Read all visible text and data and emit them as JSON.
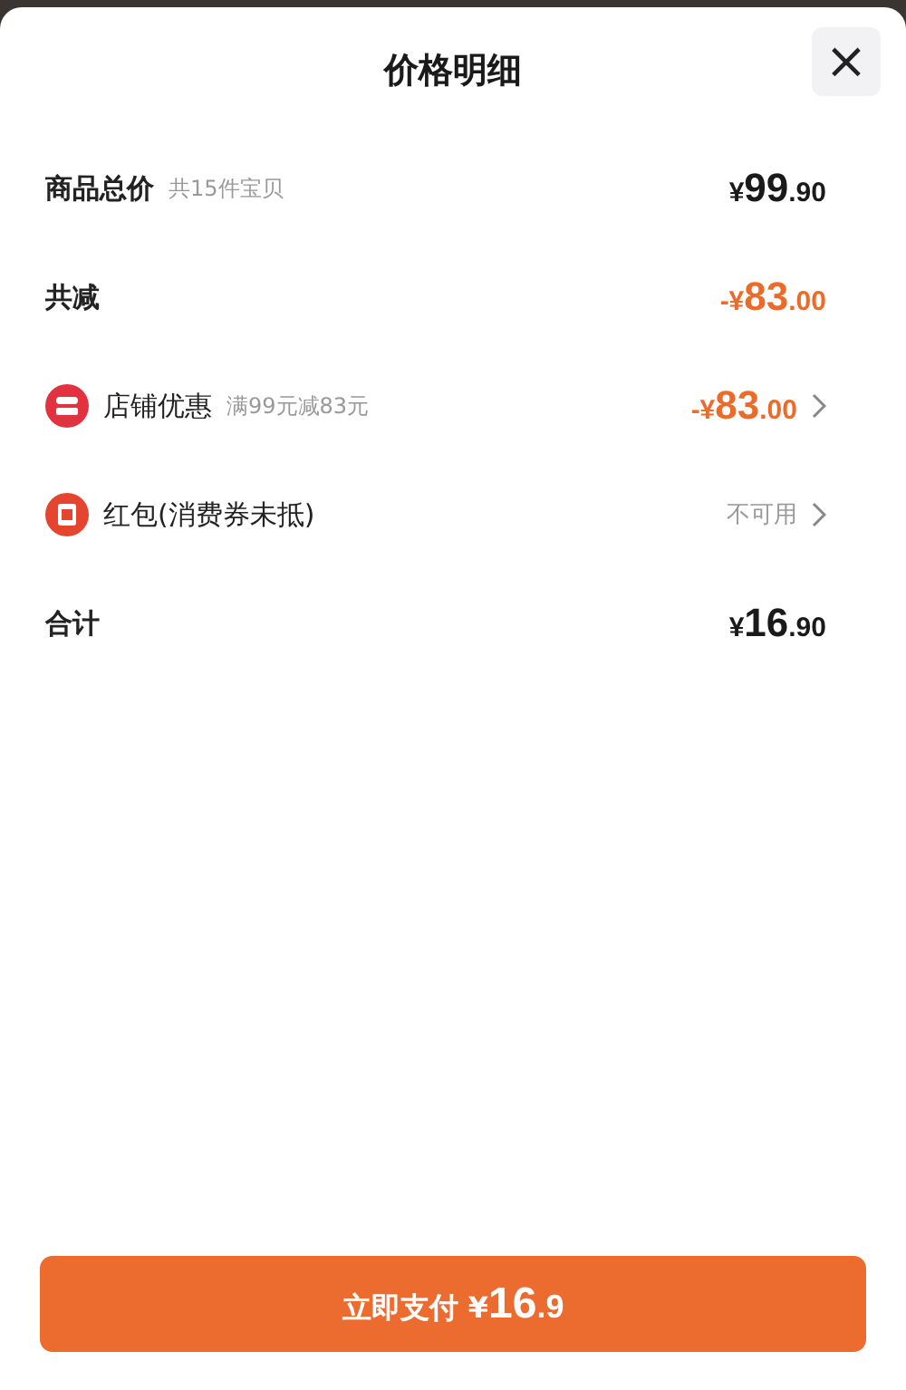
{
  "sheet": {
    "title": "价格明细",
    "close_icon": "×"
  },
  "rows": [
    {
      "kind": "plain",
      "label": "商品总价",
      "note": "共15件宝贝",
      "price": {
        "currency": "¥",
        "integer": "99",
        "decimal": ".90"
      },
      "negative": false,
      "chevron": false
    },
    {
      "kind": "plain",
      "label": "共减",
      "price": {
        "currency": "-¥",
        "integer": "83",
        "decimal": ".00"
      },
      "negative": true,
      "chevron": false
    },
    {
      "kind": "shop",
      "label": "店铺优惠",
      "note": "满99元减83元",
      "price": {
        "currency": "-¥",
        "integer": "83",
        "decimal": ".00"
      },
      "negative": true,
      "chevron": true
    },
    {
      "kind": "packet",
      "label": "红包(消费券未抵)",
      "value": "不可用",
      "chevron": true
    },
    {
      "kind": "plain",
      "label": "合计",
      "price": {
        "currency": "¥",
        "integer": "16",
        "decimal": ".90"
      },
      "negative": false,
      "chevron": false
    }
  ],
  "pay_button": {
    "label": "立即支付",
    "currency": "¥",
    "integer": "16",
    "decimal": ".9"
  }
}
